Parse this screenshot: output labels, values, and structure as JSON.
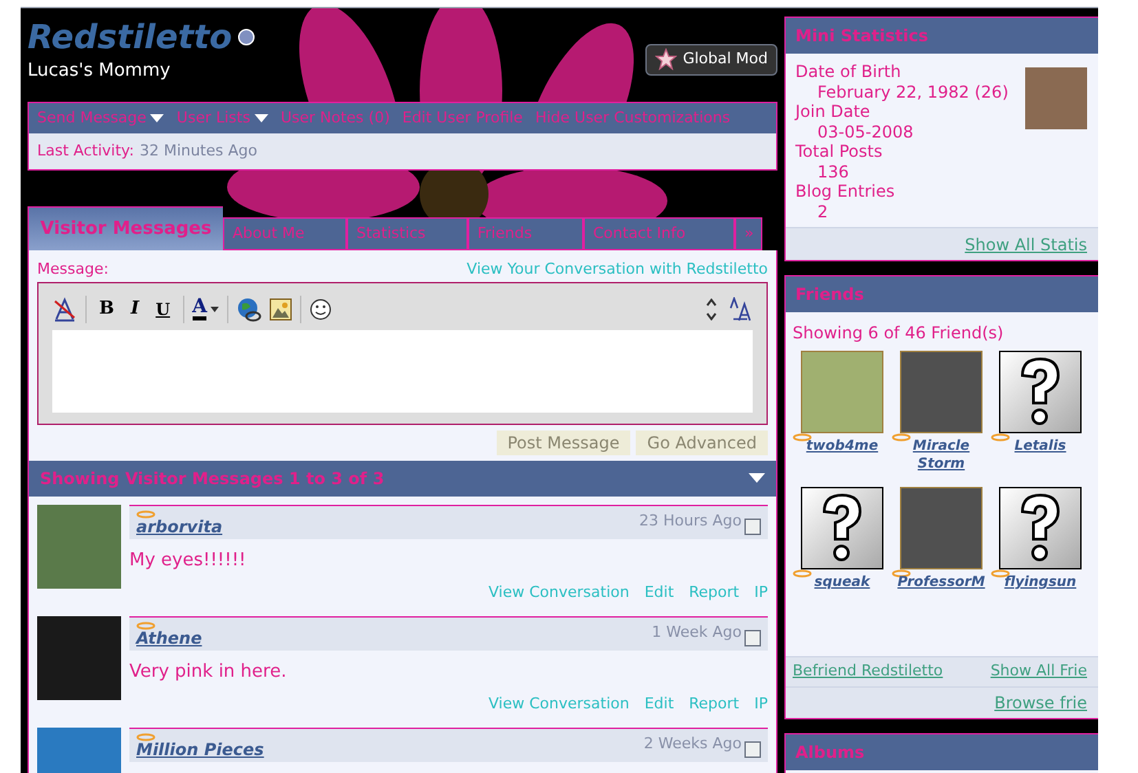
{
  "profile": {
    "username": "Redstiletto",
    "user_title": "Lucas's Mommy",
    "rank": "Global Mod",
    "online": true
  },
  "nav": {
    "links": [
      {
        "label": "Send Message",
        "menu": true
      },
      {
        "label": "User Lists",
        "menu": true
      },
      {
        "label": "User Notes (0)",
        "menu": false
      },
      {
        "label": "Edit User Profile",
        "menu": false
      },
      {
        "label": "Hide User Customizations",
        "menu": false
      }
    ],
    "last_activity_label": "Last Activity:",
    "last_activity": "32 Minutes Ago"
  },
  "tabs": [
    {
      "label": "Visitor Messages",
      "selected": true
    },
    {
      "label": "About Me",
      "selected": false
    },
    {
      "label": "Statistics",
      "selected": false
    },
    {
      "label": "Friends",
      "selected": false
    },
    {
      "label": "Contact Info",
      "selected": false
    },
    {
      "label": "»",
      "selected": false
    }
  ],
  "editor": {
    "label": "Message:",
    "conversation_link": "View Your Conversation with Redstiletto",
    "toolbar": [
      {
        "kind": "remove-format"
      },
      {
        "kind": "separator"
      },
      {
        "kind": "bold",
        "label": "B"
      },
      {
        "kind": "italic",
        "label": "I"
      },
      {
        "kind": "underline",
        "label": "U"
      },
      {
        "kind": "separator"
      },
      {
        "kind": "font-color",
        "label": "A"
      },
      {
        "kind": "separator"
      },
      {
        "kind": "link"
      },
      {
        "kind": "image"
      },
      {
        "kind": "separator"
      },
      {
        "kind": "smilie"
      }
    ],
    "buttons": [
      "Post Message",
      "Go Advanced"
    ]
  },
  "messages_header": "Showing Visitor Messages 1 to 3 of 3",
  "messages": [
    {
      "author": "arborvita",
      "time": "23 Hours Ago",
      "checked": false,
      "body": "My eyes!!!!!!",
      "actions": [
        "View Conversation",
        "Edit",
        "Report",
        "IP"
      ]
    },
    {
      "author": "Athene",
      "time": "1 Week Ago",
      "checked": false,
      "body": "Very pink in here.",
      "actions": [
        "View Conversation",
        "Edit",
        "Report",
        "IP"
      ]
    },
    {
      "author": "Million Pieces",
      "time": "2 Weeks Ago",
      "checked": false
    }
  ],
  "mini_statistics": {
    "title": "Mini Statistics",
    "items": [
      {
        "label": "Date of Birth",
        "value": "February 22, 1982 (26)"
      },
      {
        "label": "Join Date",
        "value": "03-05-2008"
      },
      {
        "label": "Total Posts",
        "value": "136"
      },
      {
        "label": "Blog Entries",
        "value": "2"
      }
    ],
    "footer_link": "Show All Statis"
  },
  "friends": {
    "title": "Friends",
    "summary": "Showing 6 of 46 Friend(s)",
    "items": [
      {
        "name": "twob4me",
        "kind": "photo"
      },
      {
        "name": "Miracle Storm",
        "kind": "photo"
      },
      {
        "name": "Letalis",
        "kind": "unknown"
      },
      {
        "name": "squeak",
        "kind": "unknown"
      },
      {
        "name": "ProfessorM",
        "kind": "photo"
      },
      {
        "name": "flyingsun",
        "kind": "unknown"
      }
    ],
    "links": [
      "Befriend Redstiletto",
      "Show All Frie"
    ],
    "browse_link": "Browse frie"
  },
  "albums": {
    "title": "Albums"
  }
}
